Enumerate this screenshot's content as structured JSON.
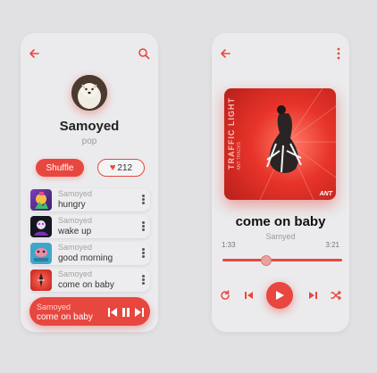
{
  "profile": {
    "name": "Samoyed",
    "subtitle": "pop",
    "shuffle_label": "Shuffle",
    "likes": "212"
  },
  "songs": [
    {
      "artist": "Samoyed",
      "title": "hungry"
    },
    {
      "artist": "Samoyed",
      "title": "wake up"
    },
    {
      "artist": "Samoyed",
      "title": "good morning"
    },
    {
      "artist": "Samoyed",
      "title": "come on baby"
    }
  ],
  "mini_player": {
    "artist": "Samoyed",
    "title": "come on baby"
  },
  "now_playing": {
    "title": "come on baby",
    "artist": "Samyed",
    "elapsed": "1:33",
    "duration": "3:21",
    "progress": 0.36,
    "art_text": "TRAFFIC LIGHT",
    "art_subtext": "ANT TRACKS",
    "art_corner": "ANT"
  },
  "colors": {
    "accent": "#e8473f",
    "background": "#e1e1e3",
    "card": "#ebebed"
  },
  "icons": [
    "back-arrow-icon",
    "search-icon",
    "more-vertical-icon",
    "heart-icon",
    "prev-icon",
    "pause-icon",
    "next-icon",
    "repeat-icon",
    "play-icon",
    "shuffle-icon"
  ]
}
